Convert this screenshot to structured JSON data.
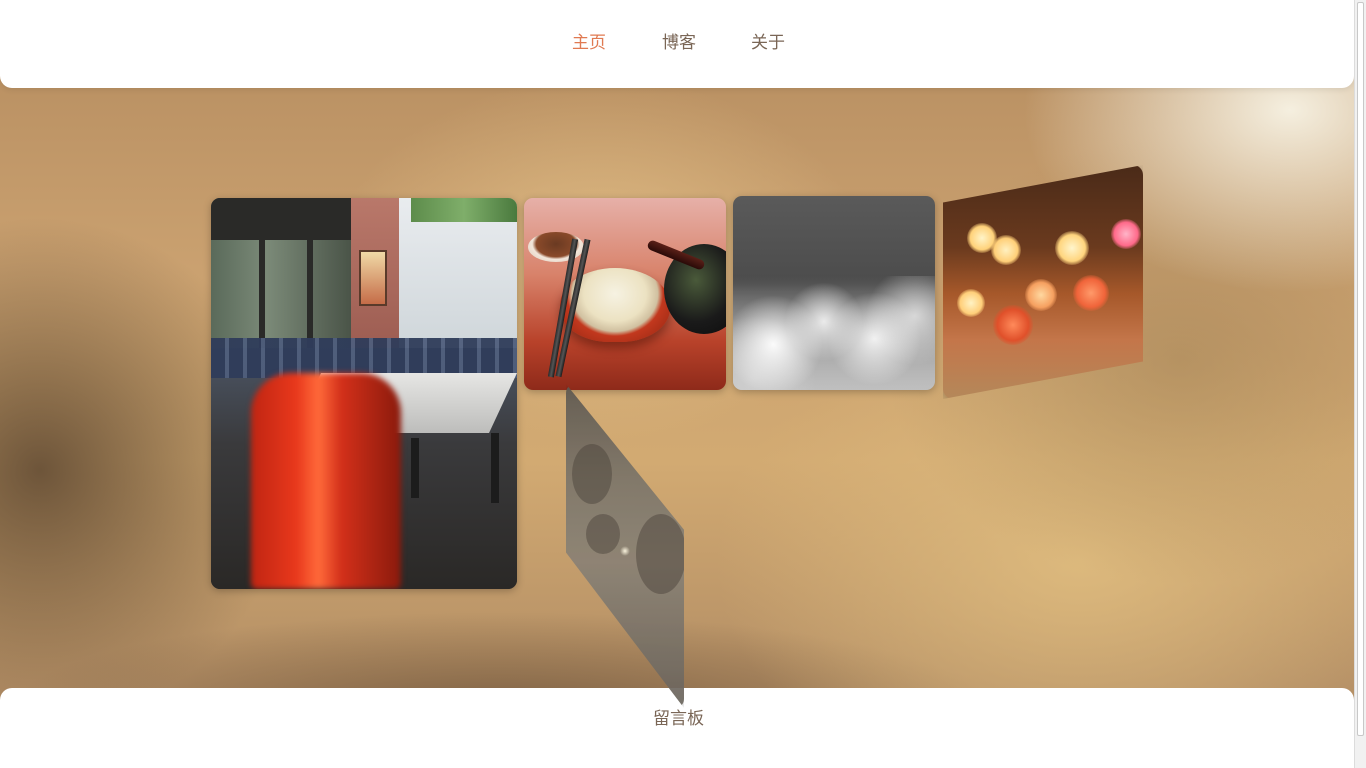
{
  "nav": {
    "items": [
      {
        "label": "主页",
        "active": true
      },
      {
        "label": "博客",
        "active": false
      },
      {
        "label": "关于",
        "active": false
      }
    ]
  },
  "footer": {
    "guestbook_label": "留言板"
  },
  "gallery": {
    "photos": [
      {
        "subject": "canteen-chairs"
      },
      {
        "subject": "rice-bowl"
      },
      {
        "subject": "snow-frost"
      },
      {
        "subject": "bokeh-lights"
      },
      {
        "subject": "foggy-trees"
      }
    ]
  },
  "colors": {
    "accent_active": "#e07a52",
    "nav_text": "#7a6656",
    "card_background": "#ffffff"
  }
}
